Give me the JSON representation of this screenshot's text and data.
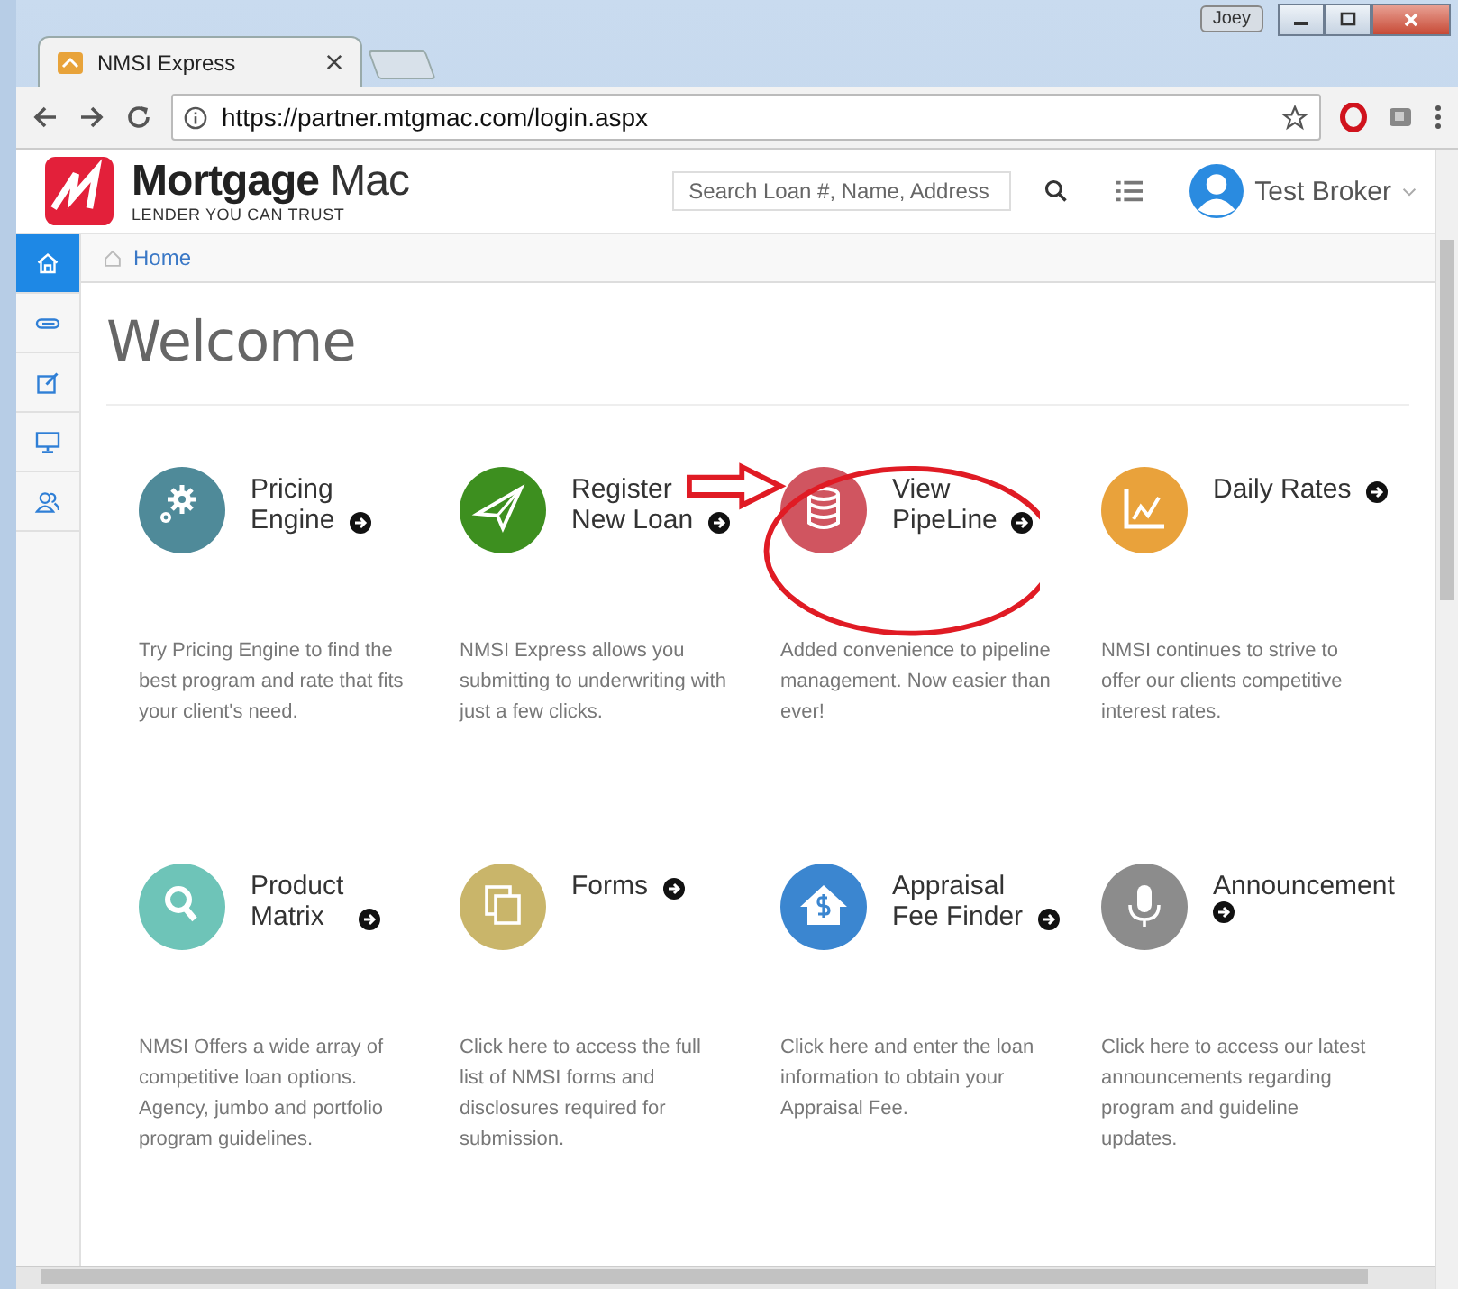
{
  "browser": {
    "tab_title": "NMSI Express",
    "user_badge": "Joey",
    "url": "https://partner.mtgmac.com/login.aspx"
  },
  "header": {
    "brand": "**Mortgage** Mac",
    "tagline": "LENDER YOU CAN TRUST",
    "search": {
      "placeholder": "Search Loan #, Name, Address"
    },
    "user": "Test Broker"
  },
  "sidebar": {
    "items": [
      {
        "kind": "home",
        "selected": true
      },
      {
        "kind": "clip",
        "selected": false
      },
      {
        "kind": "edit",
        "selected": false
      },
      {
        "kind": "monitor",
        "selected": false
      },
      {
        "kind": "users",
        "selected": false
      }
    ]
  },
  "breadcrumb": "Home",
  "title": "Welcome",
  "tiles": [
    {
      "title": [
        "Pricing",
        "Engine"
      ],
      "kind": "gears",
      "color": "#4f8a99",
      "description": "Try Pricing Engine to find the best program and rate that fits your client's need."
    },
    {
      "title": [
        "Register",
        "New Loan"
      ],
      "kind": "plane",
      "color": "#3d8f1f",
      "description": "NMSI Express allows you submitting to underwriting with just a few clicks."
    },
    {
      "title": [
        "View",
        "PipeLine"
      ],
      "kind": "database",
      "color": "#d05560",
      "description": "Added convenience to pipeline management. Now easier than ever!"
    },
    {
      "title": [
        "Daily Rates"
      ],
      "kind": "chart",
      "color": "#e9a23b",
      "description": "NMSI continues to strive to offer our clients competitive interest rates."
    },
    {
      "title": [
        "Product",
        "Matrix"
      ],
      "kind": "search",
      "color": "#6ec4b8",
      "description": "NMSI Offers a wide array of competitive loan options. Agency, jumbo and portfolio program guidelines."
    },
    {
      "title": [
        "Forms"
      ],
      "kind": "copy",
      "color": "#c9b56a",
      "description": "Click here to access the full list of NMSI forms and disclosures required for submission."
    },
    {
      "title": [
        "Appraisal",
        "Fee Finder"
      ],
      "kind": "house",
      "color": "#3b86d0",
      "description": "Click here and enter the loan information to obtain your Appraisal Fee."
    },
    {
      "title": [
        "Announcement"
      ],
      "kind": "mic",
      "color": "#8c8c8c",
      "description": "Click here to access our latest announcements regarding program and guideline updates."
    }
  ]
}
